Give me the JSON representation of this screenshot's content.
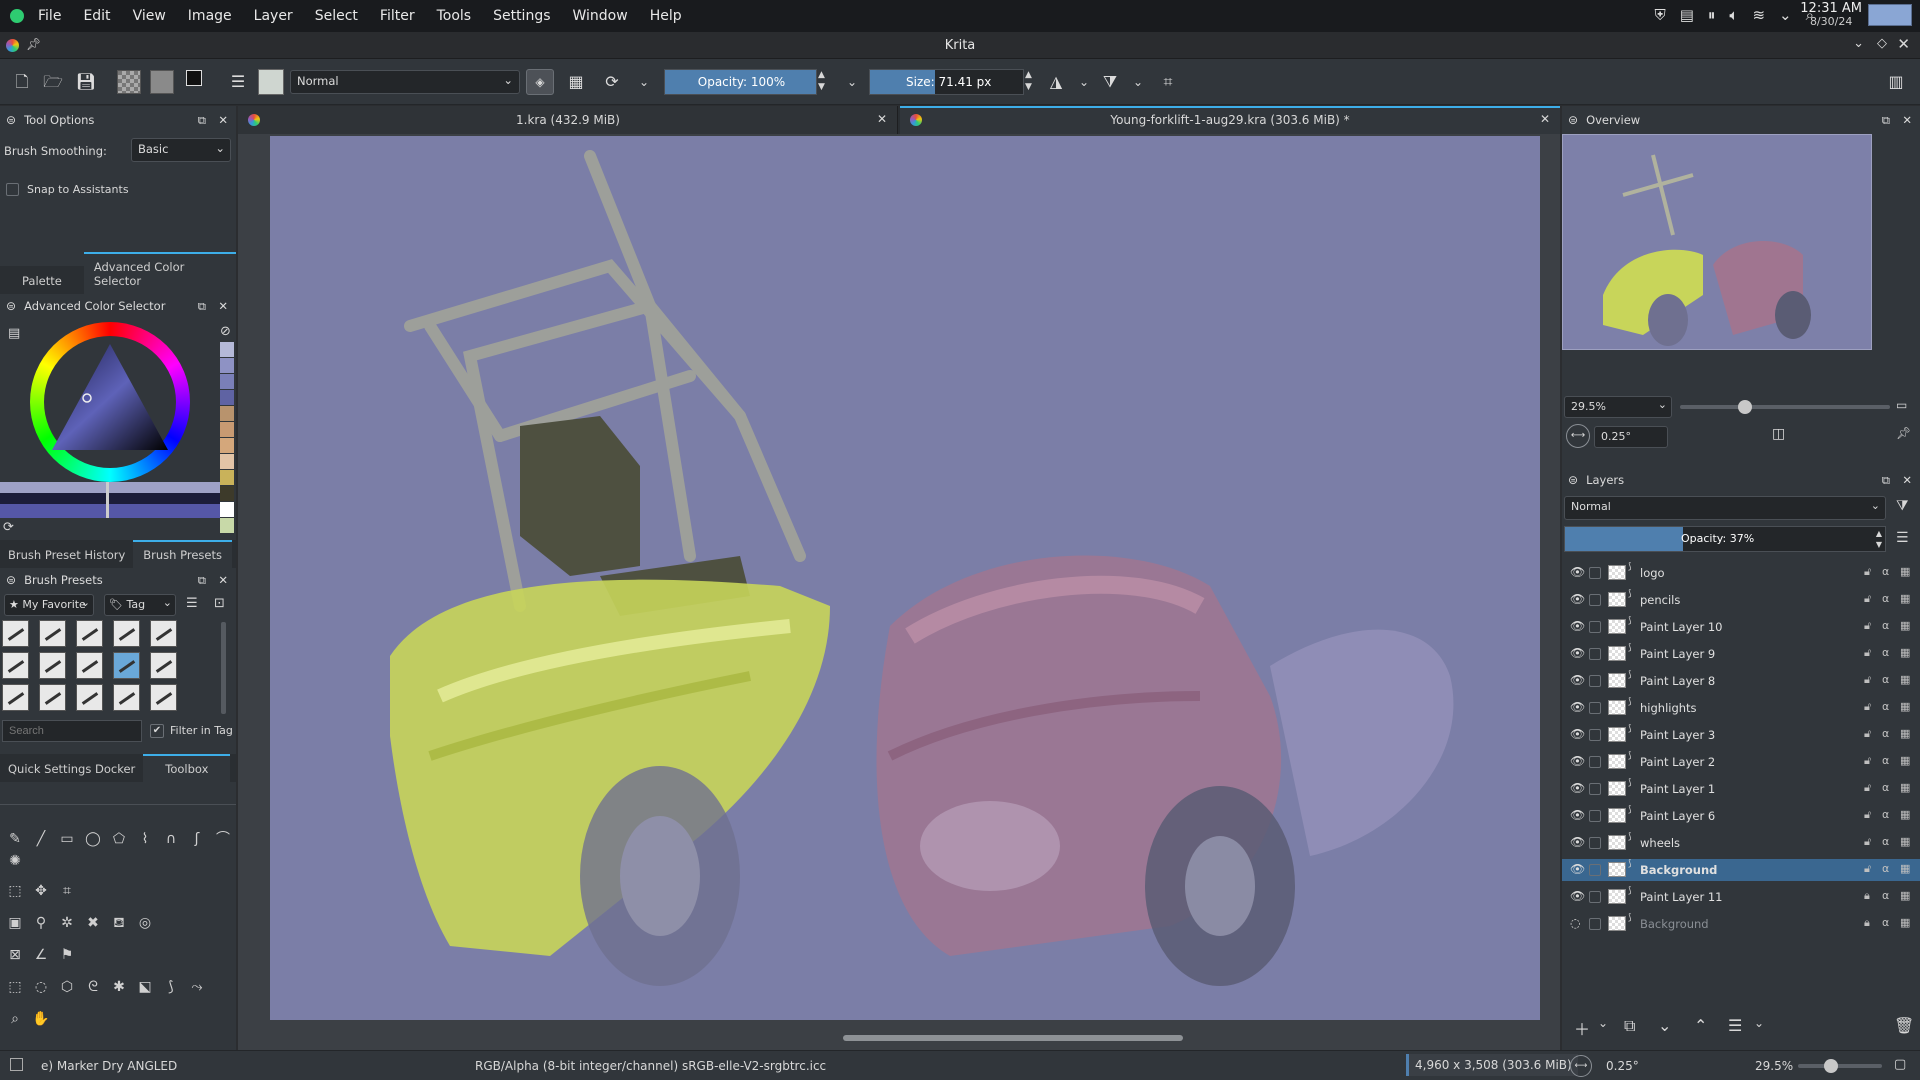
{
  "system": {
    "menu": [
      "File",
      "Edit",
      "View",
      "Image",
      "Layer",
      "Select",
      "Filter",
      "Tools",
      "Settings",
      "Window",
      "Help"
    ],
    "time": "12:31 AM",
    "date": "8/30/24"
  },
  "app_title": "Krita",
  "toolbar": {
    "blend_mode": "Normal",
    "opacity_label": "Opacity: 100%",
    "size_label": "Size:",
    "size_value": "71.41 px"
  },
  "tool_options": {
    "title": "Tool Options",
    "brush_smoothing_label": "Brush Smoothing:",
    "brush_smoothing_value": "Basic",
    "snap_label": "Snap to Assistants"
  },
  "color_tabs": [
    "Palette",
    "Advanced Color Selector"
  ],
  "color_panel_title": "Advanced Color Selector",
  "recent_colors": [
    "#b5b9d8",
    "#8e92c4",
    "#7a7fb8",
    "#5f63a3",
    "#b8936d",
    "#c89a72",
    "#d4a77b",
    "#e3c4a6",
    "#c9b25a",
    "#3d3a2a",
    "#ffffff",
    "#c8d9a8"
  ],
  "brush_tabs": [
    "Brush Preset History",
    "Brush Presets"
  ],
  "brush_presets": {
    "title": "Brush Presets",
    "tag_filter": "My Favorite",
    "tag_button": "Tag",
    "search_placeholder": "Search",
    "filter_label": "Filter in Tag"
  },
  "tool_tabs": [
    "Quick Settings Docker",
    "Toolbox"
  ],
  "documents": [
    {
      "title": "1.kra (432.9 MiB)"
    },
    {
      "title": "Young-forklift-1-aug29.kra (303.6 MiB) *"
    }
  ],
  "overview": {
    "title": "Overview",
    "zoom": "29.5%",
    "rotation": "0.25°"
  },
  "layers": {
    "title": "Layers",
    "blend_mode": "Normal",
    "opacity_label": "Opacity:  37%",
    "opacity_value": 0.37,
    "items": [
      {
        "name": "logo",
        "visible": true,
        "selected": false,
        "locked": false
      },
      {
        "name": "pencils",
        "visible": true,
        "selected": false,
        "locked": false
      },
      {
        "name": "Paint Layer 10",
        "visible": true,
        "selected": false,
        "locked": false
      },
      {
        "name": "Paint Layer 9",
        "visible": true,
        "selected": false,
        "locked": false
      },
      {
        "name": "Paint Layer 8",
        "visible": true,
        "selected": false,
        "locked": false
      },
      {
        "name": "highlights",
        "visible": true,
        "selected": false,
        "locked": false
      },
      {
        "name": "Paint Layer 3",
        "visible": true,
        "selected": false,
        "locked": false
      },
      {
        "name": "Paint Layer 2",
        "visible": true,
        "selected": false,
        "locked": false
      },
      {
        "name": "Paint Layer 1",
        "visible": true,
        "selected": false,
        "locked": false
      },
      {
        "name": "Paint Layer 6",
        "visible": true,
        "selected": false,
        "locked": false
      },
      {
        "name": "wheels",
        "visible": true,
        "selected": false,
        "locked": false
      },
      {
        "name": "Background",
        "visible": true,
        "selected": true,
        "locked": false
      },
      {
        "name": "Paint Layer 11",
        "visible": true,
        "selected": false,
        "locked": true
      },
      {
        "name": "Background",
        "visible": false,
        "selected": false,
        "locked": true
      }
    ]
  },
  "status": {
    "brush": "e) Marker Dry ANGLED",
    "color_space": "RGB/Alpha (8-bit integer/channel)  sRGB-elle-V2-srgbtrc.icc",
    "image_size": "4,960 x 3,508 (303.6 MiB)",
    "rotation": "0.25°",
    "zoom": "29.5%"
  }
}
